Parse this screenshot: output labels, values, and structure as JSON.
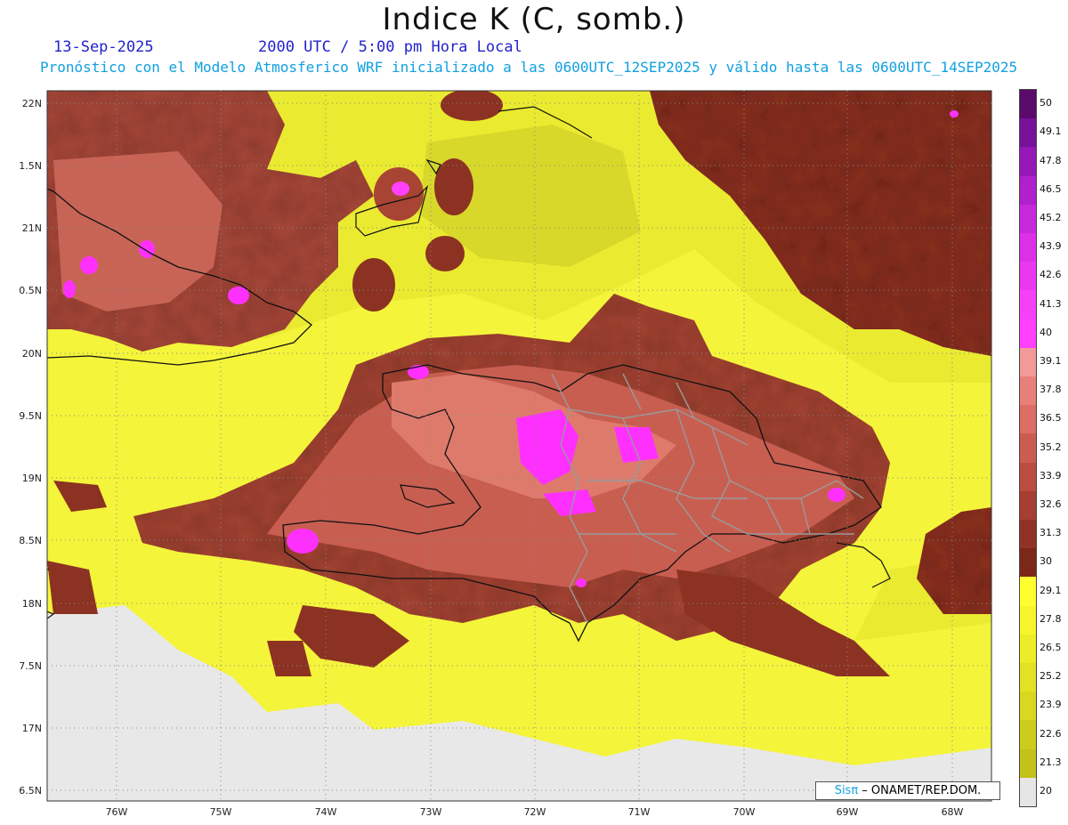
{
  "title": "Indice K (C, somb.)",
  "date": "13-Sep-2025",
  "valid_time": "2000 UTC / 5:00 pm Hora Local",
  "forecast_info": "Pronóstico con el Modelo Atmosferico WRF inicializado a las 0600UTC_12SEP2025 y válido hasta las  0600UTC_14SEP2025",
  "credit_prefix": "Sisπ",
  "credit_suffix": " – ONAMET/REP.DOM.",
  "lat_labels": [
    "22N",
    "1.5N",
    "21N",
    "0.5N",
    "20N",
    "9.5N",
    "19N",
    "8.5N",
    "18N",
    "7.5N",
    "17N",
    "6.5N"
  ],
  "lon_labels": [
    "76W",
    "75W",
    "74W",
    "73W",
    "72W",
    "71W",
    "70W",
    "69W",
    "68W"
  ],
  "colorbar": {
    "labels": [
      "50",
      "49.1",
      "47.8",
      "46.5",
      "45.2",
      "43.9",
      "42.6",
      "41.3",
      "40",
      "39.1",
      "37.8",
      "36.5",
      "35.2",
      "33.9",
      "32.6",
      "31.3",
      "30",
      "29.1",
      "27.8",
      "26.5",
      "25.2",
      "23.9",
      "22.6",
      "21.3",
      "20"
    ],
    "colors": [
      "#5a0a6a",
      "#78109a",
      "#9618b8",
      "#b020cc",
      "#c828dc",
      "#dc30e8",
      "#ea38f0",
      "#f540f8",
      "#ff40ff",
      "#f29a98",
      "#e8807a",
      "#dc6e66",
      "#cc5c52",
      "#ba4c42",
      "#a63e34",
      "#903226",
      "#7c2818",
      "#ffff30",
      "#f6f52c",
      "#ecec28",
      "#e2e224",
      "#d8d820",
      "#cccc1c",
      "#c2c218",
      "#e6e6e6"
    ]
  }
}
